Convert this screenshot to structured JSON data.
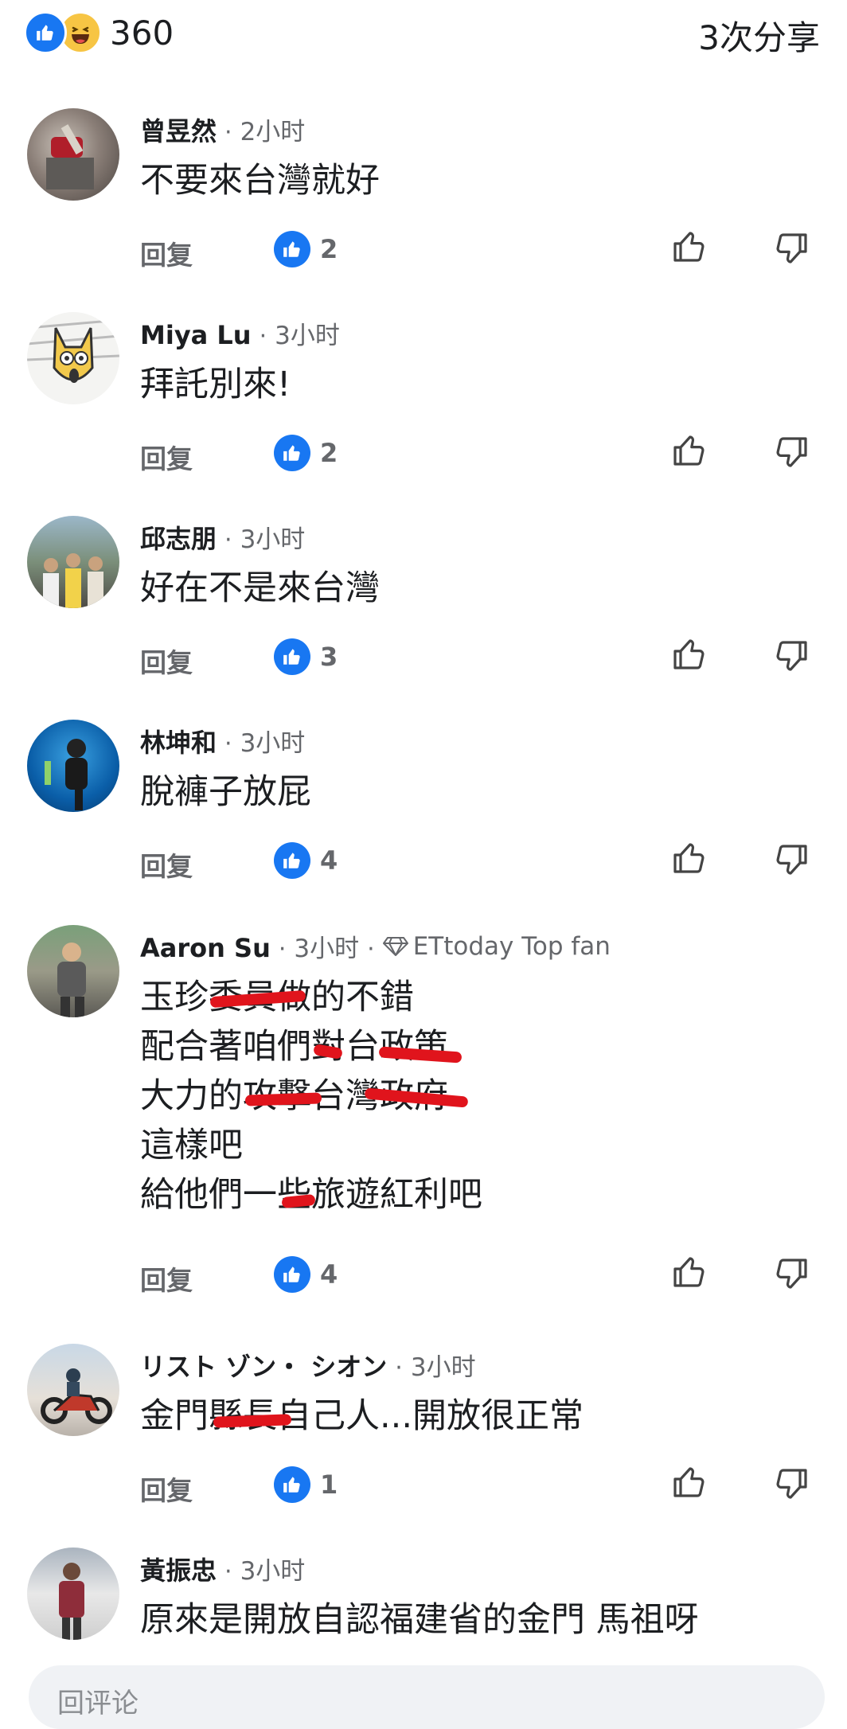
{
  "header": {
    "reaction_count": "360",
    "shares": "3次分享"
  },
  "labels": {
    "reply": "回复",
    "dot": "·"
  },
  "comments": [
    {
      "author": "曾昱然",
      "time": "2小时",
      "lines": [
        "不要來台灣就好"
      ],
      "likes": "2"
    },
    {
      "author": "Miya Lu",
      "time": "3小时",
      "lines": [
        "拜託別來!"
      ],
      "likes": "2"
    },
    {
      "author": "邱志朋",
      "time": "3小时",
      "lines": [
        "好在不是來台灣"
      ],
      "likes": "3"
    },
    {
      "author": "林坤和",
      "time": "3小时",
      "lines": [
        "脫褲子放屁"
      ],
      "likes": "4"
    },
    {
      "author": "Aaron Su",
      "time": "3小时",
      "badge": "ETtoday Top fan",
      "lines": [
        "玉珍委員做的不錯",
        "配合著咱們對台政策",
        "大力的攻擊台灣政府",
        "這樣吧",
        "給他們一些旅遊紅利吧"
      ],
      "likes": "4"
    },
    {
      "author": "リスト ゾン・ シオン",
      "time": "3小时",
      "lines": [
        "金門縣長自己人...開放很正常"
      ],
      "likes": "1"
    },
    {
      "author": "黃振忠",
      "time": "3小时",
      "lines": [
        "原來是開放自認福建省的金門 馬祖呀"
      ]
    }
  ],
  "input": {
    "placeholder": "回评论"
  },
  "colors": {
    "accent": "#1877f2",
    "muted": "#65676b",
    "redaction": "#e0141c"
  }
}
